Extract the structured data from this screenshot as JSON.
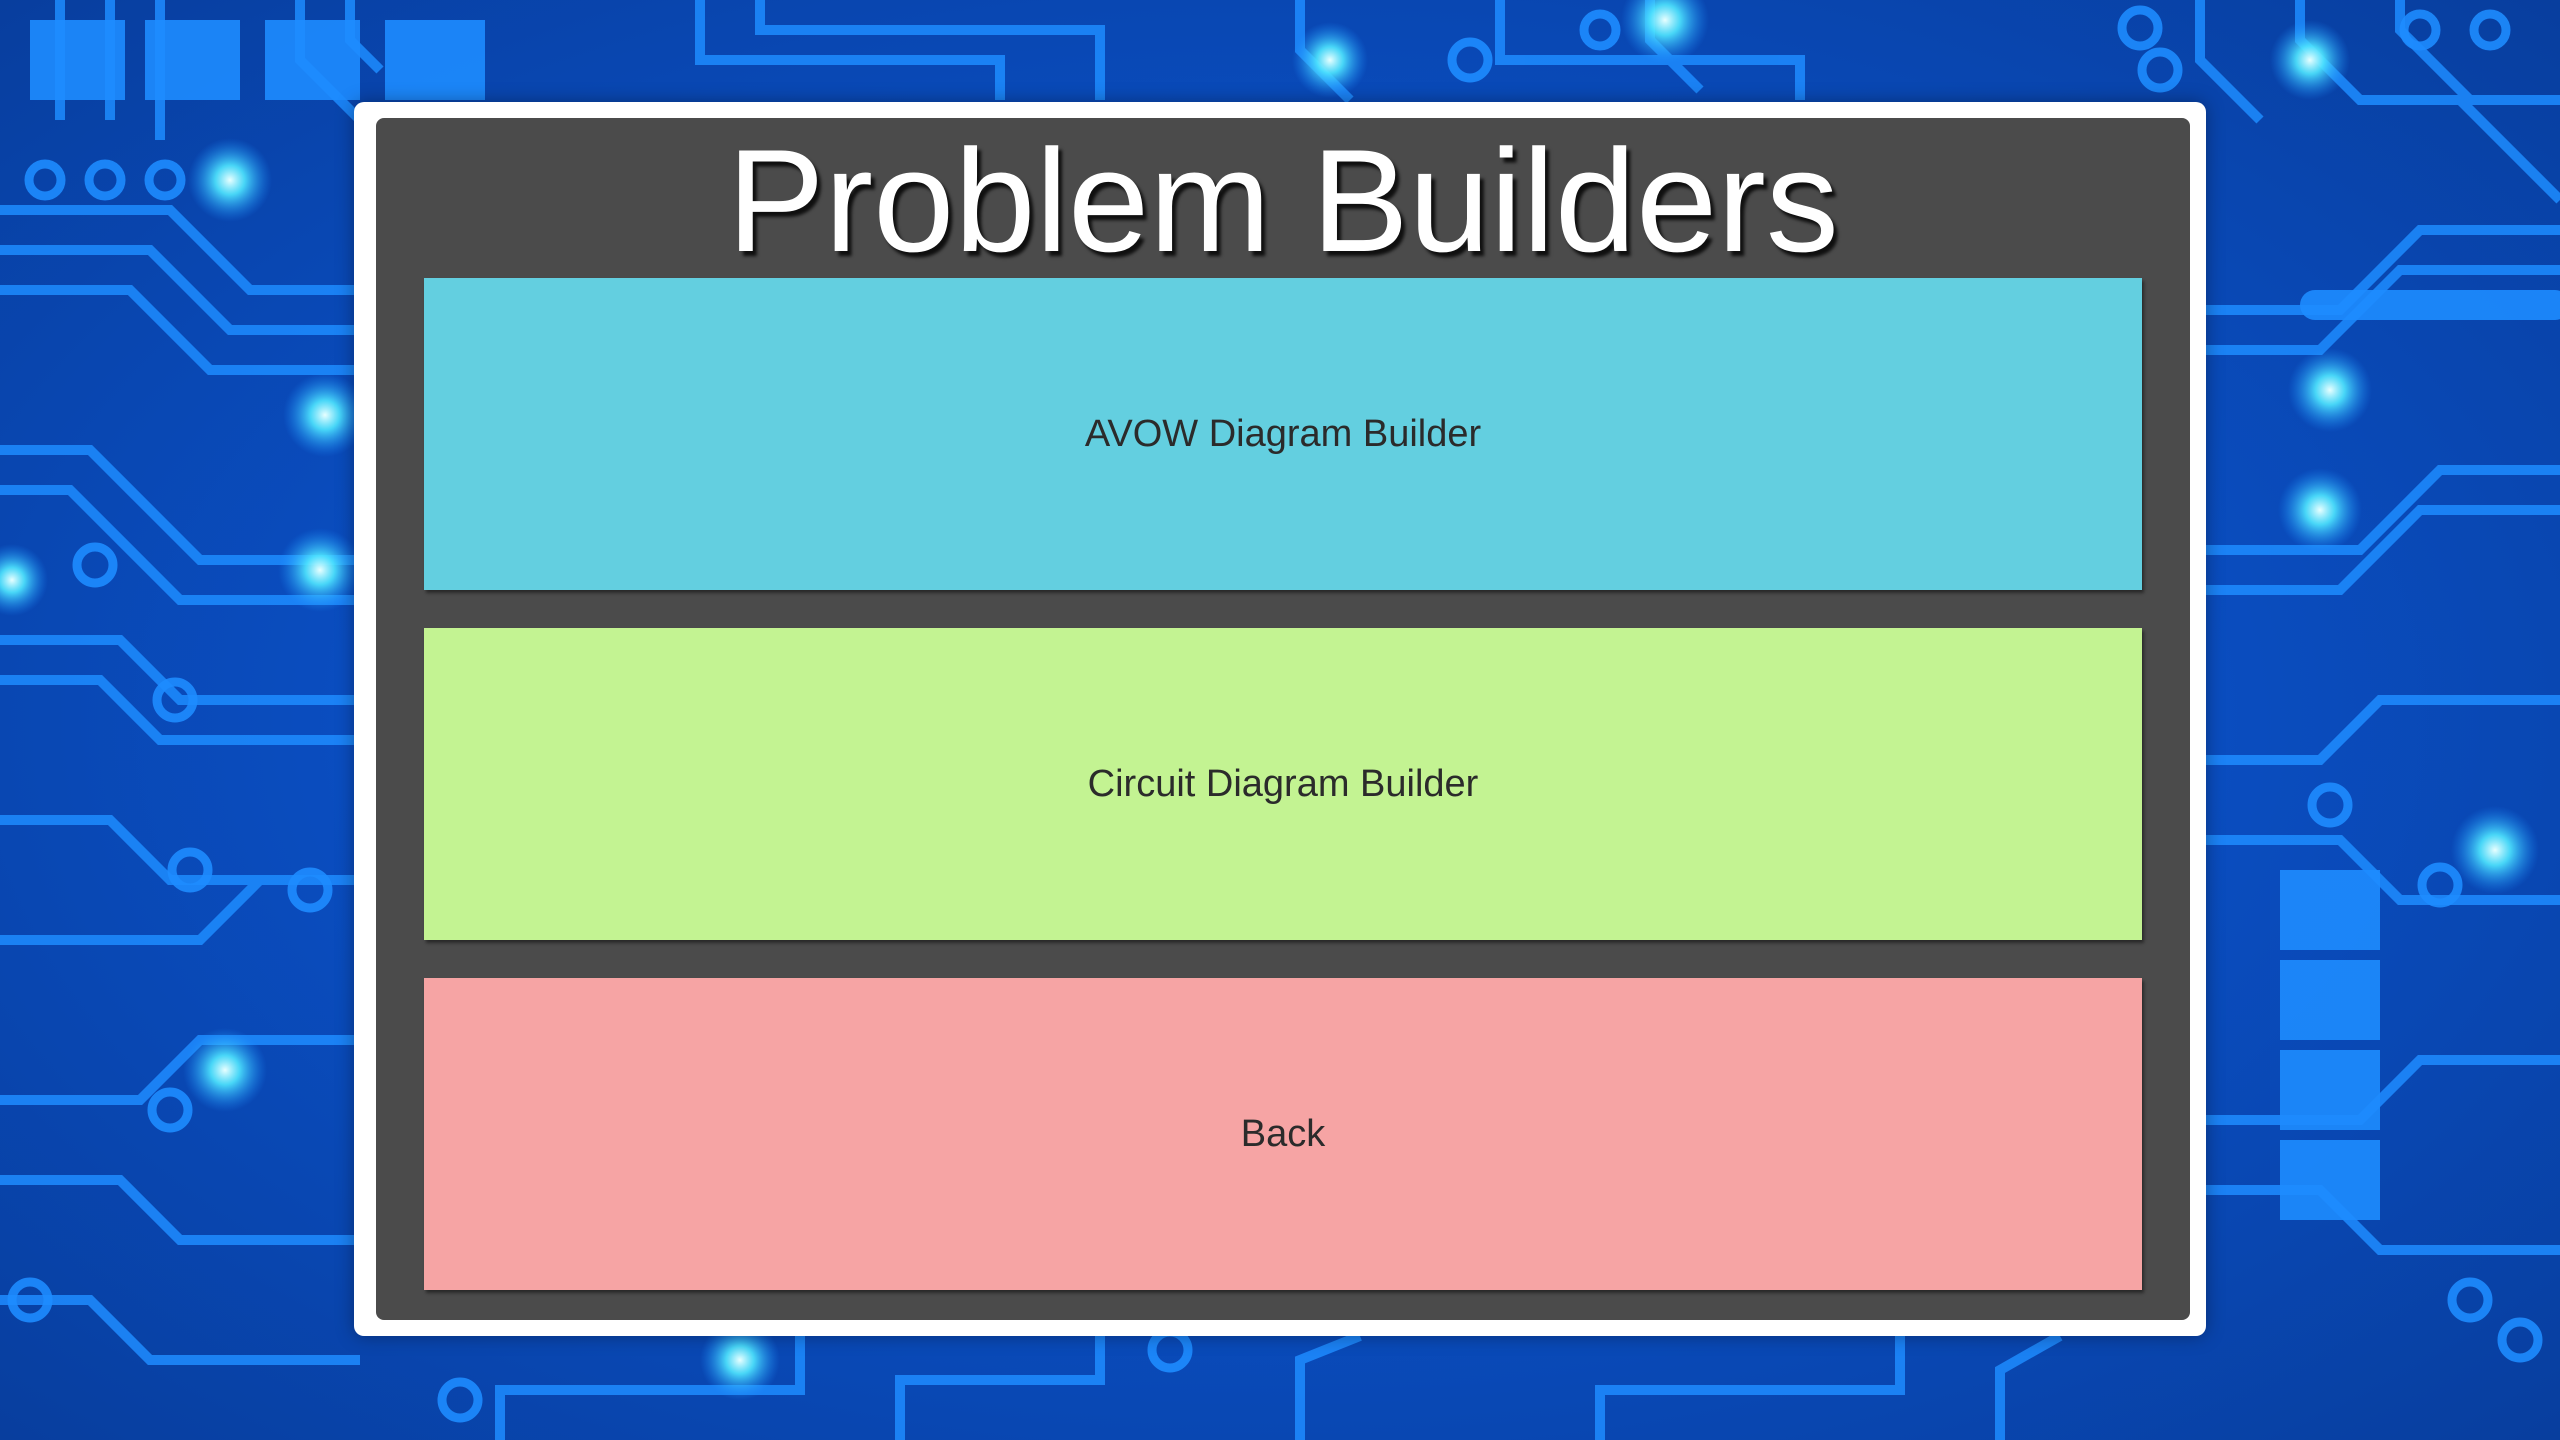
{
  "title": "Problem Builders",
  "buttons": {
    "avow": {
      "label": "AVOW Diagram Builder",
      "color": "#63cfe0"
    },
    "circuit": {
      "label": "Circuit Diagram Builder",
      "color": "#c3f392"
    },
    "back": {
      "label": "Back",
      "color": "#f6a4a4"
    }
  },
  "colors": {
    "panel_border": "#ffffff",
    "panel_fill": "#4b4b4b",
    "title_text": "#ffffff",
    "background": "#0a4fc4",
    "circuit_glow": "#35e0ff"
  }
}
